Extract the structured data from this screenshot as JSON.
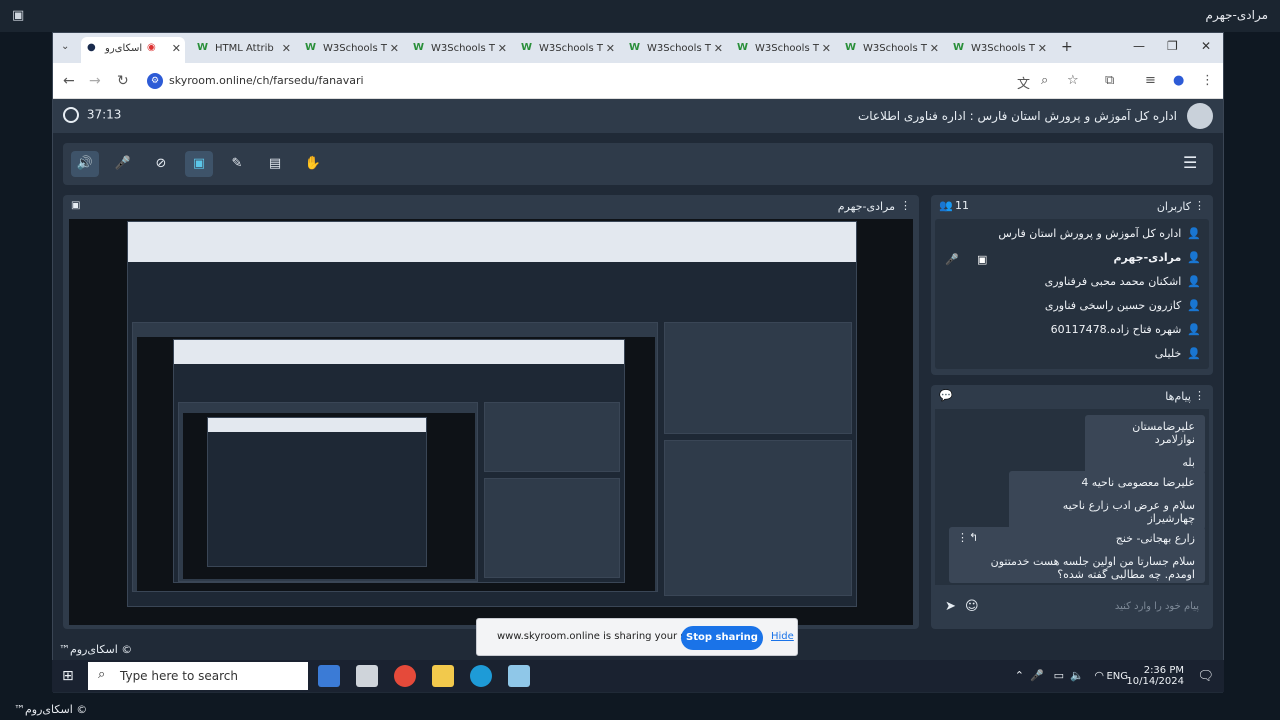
{
  "outer": {
    "title": "مرادی-جهرم",
    "bottom_brand": "™اسکای‌روم ©"
  },
  "browser": {
    "tabs": [
      {
        "label": "اسکای‌رو",
        "active": true
      },
      {
        "label": "HTML Attrib"
      },
      {
        "label": "W3Schools T"
      },
      {
        "label": "W3Schools T"
      },
      {
        "label": "W3Schools T"
      },
      {
        "label": "W3Schools T"
      },
      {
        "label": "W3Schools T"
      },
      {
        "label": "W3Schools T"
      },
      {
        "label": "W3Schools T"
      }
    ],
    "url": "skyroom.online/ch/farsedu/fanavari"
  },
  "app": {
    "timer": "37:13",
    "room_title": "اداره کل آموزش و پرورش استان فارس : اداره فناوری اطلاعات",
    "stage_name": "مرادی-جهرم",
    "users": {
      "title": "کاربران",
      "count": "11",
      "list": [
        {
          "name": "اداره کل آموزش و پرورش استان فارس",
          "bold": false
        },
        {
          "name": "مرادی-جهرم",
          "bold": true
        },
        {
          "name": "اشکنان محمد محبی فرفناوری",
          "bold": false
        },
        {
          "name": "کازرون حسین راسخی فناوری",
          "bold": false
        },
        {
          "name": "60117478.شهره فتاح زاده",
          "bold": false
        },
        {
          "name": "خلیلی",
          "bold": false
        }
      ]
    },
    "messages": {
      "title": "پیام‌ها",
      "items": [
        {
          "author": "علیرضامستان نوازلامرد",
          "text": "بله"
        },
        {
          "author": "علیرضا معصومی ناحیه 4",
          "text": "سلام و عرض ادب زارع ناحیه چهارشیراز"
        },
        {
          "author": "زارع بهجانی- خنج",
          "text": "سلام جسارتا من اولین جلسه هست خدمتتون اومدم. چه مطالبی گفته شده؟"
        }
      ],
      "input_placeholder": "پیام خود را وارد کنید"
    },
    "brand": "™اسکای‌روم ©"
  },
  "share_bar": {
    "text": "www.skyroom.online is sharing your screen.",
    "stop": "Stop sharing",
    "hide": "Hide"
  },
  "taskbar": {
    "search_placeholder": "Type here to search",
    "lang": "ENG",
    "time": "2:36 PM",
    "date": "10/14/2024"
  }
}
